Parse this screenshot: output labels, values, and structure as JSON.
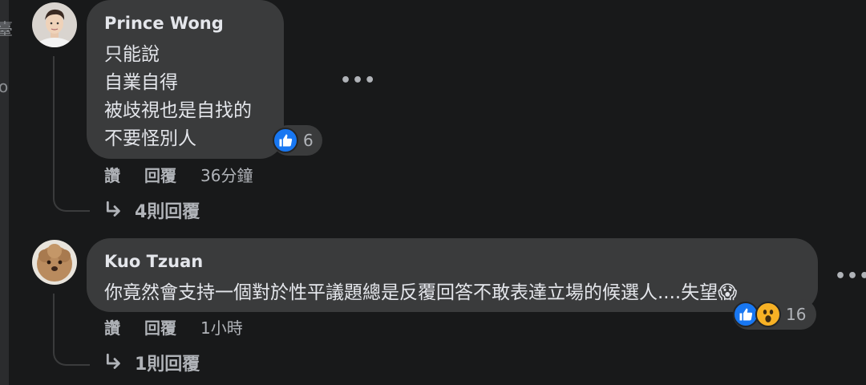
{
  "sidebar": {
    "partial_glyph": "臺",
    "partial_char": "o"
  },
  "comments": [
    {
      "author": "Prince Wong",
      "lines": [
        "只能說",
        "自業自得",
        "被歧視也是自找的",
        "不要怪別人"
      ],
      "reactions": {
        "types": [
          "like"
        ],
        "count": "6"
      },
      "actions": {
        "like": "讚",
        "reply": "回覆",
        "time": "36分鐘"
      },
      "replies_link": "4則回覆",
      "more_icon": "more-options-icon"
    },
    {
      "author": "Kuo Tzuan",
      "lines": [
        "你竟然會支持一個對於性平議題總是反覆回答不敢表達立場的候選人....失望😱"
      ],
      "reactions": {
        "types": [
          "like",
          "wow"
        ],
        "count": "16"
      },
      "actions": {
        "like": "讚",
        "reply": "回覆",
        "time": "1小時"
      },
      "replies_link": "1則回覆",
      "more_icon": "more-options-icon"
    }
  ],
  "colors": {
    "background": "#18191a",
    "bubble": "#3a3b3c",
    "text": "#e4e6eb",
    "secondary": "#b0b3b8",
    "like_blue": "#1877f2",
    "wow_yellow": "#f7b125"
  }
}
